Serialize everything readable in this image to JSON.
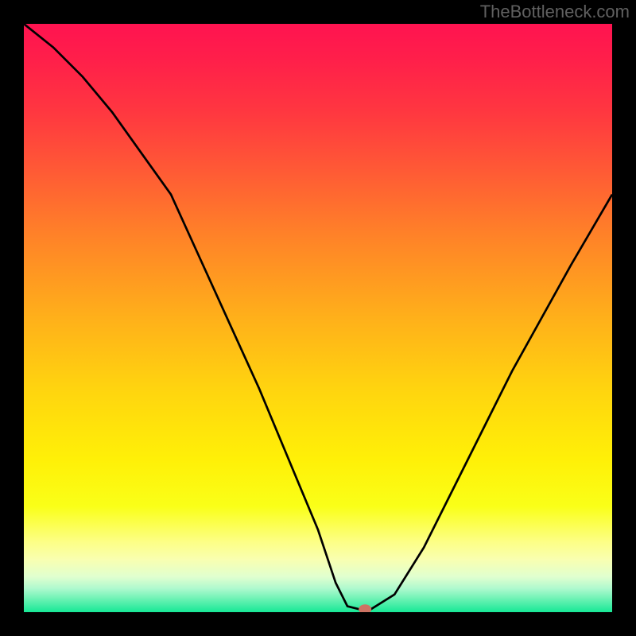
{
  "watermark": "TheBottleneck.com",
  "chart_data": {
    "type": "line",
    "title": "",
    "xlabel": "",
    "ylabel": "",
    "xlim": [
      0,
      100
    ],
    "ylim": [
      0,
      100
    ],
    "series": [
      {
        "name": "bottleneck-curve",
        "x": [
          0,
          5,
          10,
          15,
          20,
          25,
          30,
          35,
          40,
          45,
          50,
          53,
          55,
          57,
          59,
          63,
          68,
          73,
          78,
          83,
          88,
          93,
          100
        ],
        "values": [
          100,
          96,
          91,
          85,
          78,
          71,
          60,
          49,
          38,
          26,
          14,
          5,
          1,
          0.5,
          0.5,
          3,
          11,
          21,
          31,
          41,
          50,
          59,
          71
        ]
      },
      {
        "name": "optimal-marker",
        "x": [
          58
        ],
        "values": [
          0.5
        ]
      }
    ],
    "colors": {
      "curve": "#000000",
      "marker": "#cd7363"
    }
  }
}
